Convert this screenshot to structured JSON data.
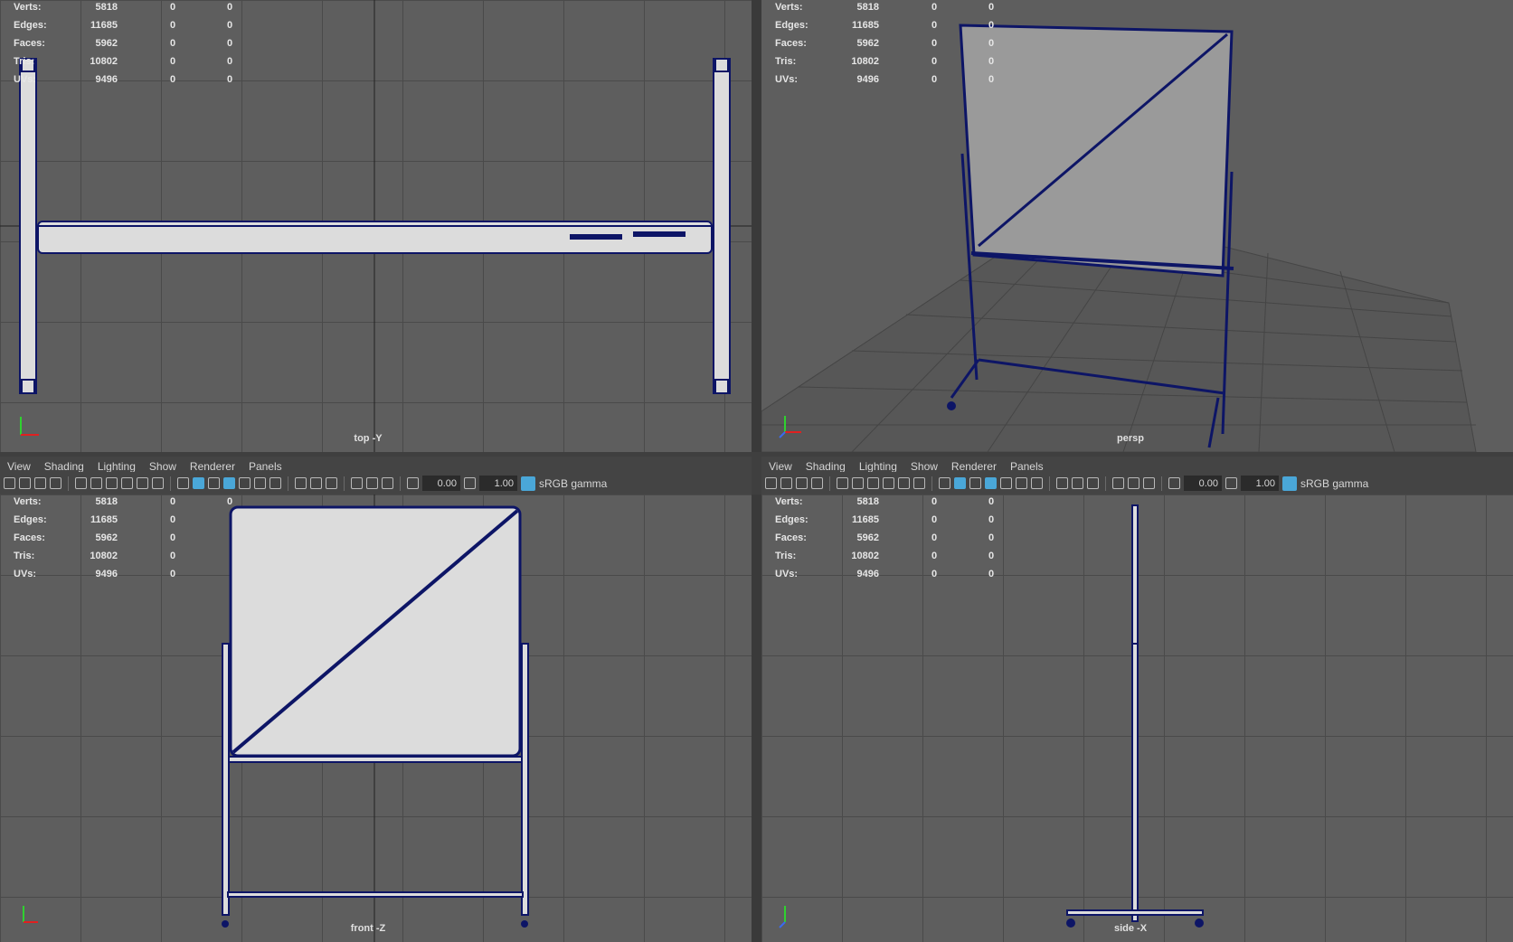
{
  "stats": {
    "labels": [
      "Verts:",
      "Edges:",
      "Faces:",
      "Tris:",
      "UVs:"
    ],
    "values": [
      "5818",
      "11685",
      "5962",
      "10802",
      "9496"
    ],
    "zeros": [
      "0",
      "0",
      "0",
      "0",
      "0"
    ]
  },
  "menu": {
    "items": [
      "View",
      "Shading",
      "Lighting",
      "Show",
      "Renderer",
      "Panels"
    ]
  },
  "toolbar": {
    "field1": "0.00",
    "field2": "1.00",
    "colorspace": "sRGB gamma"
  },
  "viewports": {
    "top": "top -Y",
    "persp": "persp",
    "front": "front -Z",
    "side": "side -X"
  },
  "colors": {
    "wire": "#0d1566",
    "surface": "#dcdcdc",
    "grid": "#4a4a4a",
    "bg": "#5e5e5e",
    "accent": "#4aa7d8"
  }
}
